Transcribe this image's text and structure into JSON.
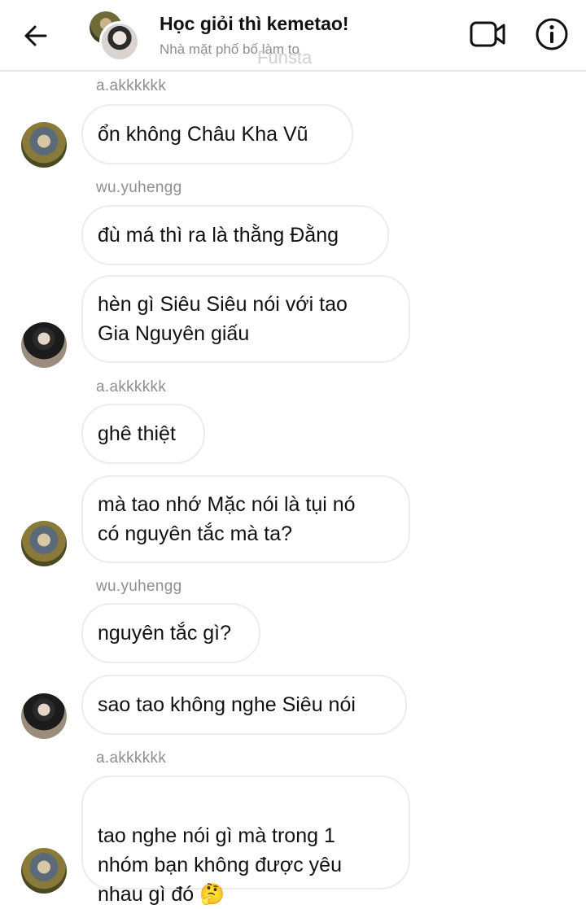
{
  "header": {
    "title": "Học giỏi thì kemetao!",
    "subtitle": "Nhà mặt phố bố làm to",
    "watermark": "Funsta"
  },
  "icons": {
    "back": "arrow-left-icon",
    "video": "video-camera-icon",
    "info": "info-icon"
  },
  "messages": [
    {
      "sender": "a.akkkkkk"
    },
    {
      "text": "ổn không Châu Kha Vũ"
    },
    {
      "sender": "wu.yuhengg"
    },
    {
      "text": "đù má thì ra là thằng Đằng"
    },
    {
      "text": "hèn gì Siêu Siêu nói với tao\nGia Nguyên giấu"
    },
    {
      "sender": "a.akkkkkk"
    },
    {
      "text": "ghê thiệt"
    },
    {
      "text": "mà tao nhớ Mặc nói là tụi nó\ncó nguyên tắc mà ta?"
    },
    {
      "sender": "wu.yuhengg"
    },
    {
      "text": "nguyên tắc gì?"
    },
    {
      "text": "sao tao không nghe Siêu nói"
    },
    {
      "sender": "a.akkkkkk"
    },
    {
      "text": "tao nghe nói gì mà trong 1\nnhóm bạn không được yêu\nnhau gì đó",
      "emoji": "🤔"
    }
  ]
}
